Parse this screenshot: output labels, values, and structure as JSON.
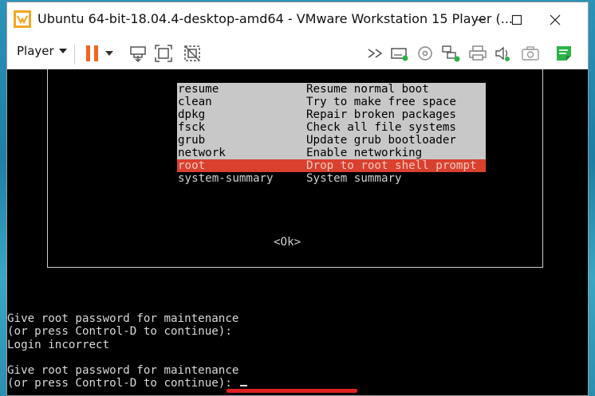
{
  "window": {
    "title": "Ubuntu 64-bit-18.04.4-desktop-amd64 - VMware Workstation 15 Player (..."
  },
  "window_controls": {
    "minimize_icon": "minimize-icon",
    "maximize_icon": "maximize-icon",
    "close_icon": "close-icon"
  },
  "toolbar": {
    "player_label": "Player",
    "icons": [
      "pause-icon",
      "send-ctrl-alt-del-icon",
      "fit-guest-icon",
      "unity-icon",
      "fast-forward-icon",
      "hard-disk-icon",
      "cd-dvd-icon",
      "network-icon",
      "printer-icon",
      "sound-icon",
      "camera-icon",
      "notes-icon"
    ],
    "pause_color": "#f26522",
    "notes_color": "#2db24a"
  },
  "recovery_menu": {
    "items": [
      {
        "key": "resume",
        "desc": "Resume normal boot"
      },
      {
        "key": "clean",
        "desc": "Try to make free space"
      },
      {
        "key": "dpkg",
        "desc": "Repair broken packages"
      },
      {
        "key": "fsck",
        "desc": "Check all file systems"
      },
      {
        "key": "grub",
        "desc": "Update grub bootloader"
      },
      {
        "key": "network",
        "desc": "Enable networking"
      },
      {
        "key": "root",
        "desc": "Drop to root shell prompt"
      },
      {
        "key": "system-summary",
        "desc": "System summary"
      }
    ],
    "selected_index": 6,
    "ok_label": "<Ok>",
    "selected_color": "#d9412e"
  },
  "console": {
    "line1": "Give root password for maintenance",
    "line2": "(or press Control-D to continue):",
    "line3": "Login incorrect",
    "line4": "",
    "line5": "Give root password for maintenance",
    "line6": "(or press Control-D to continue): "
  }
}
